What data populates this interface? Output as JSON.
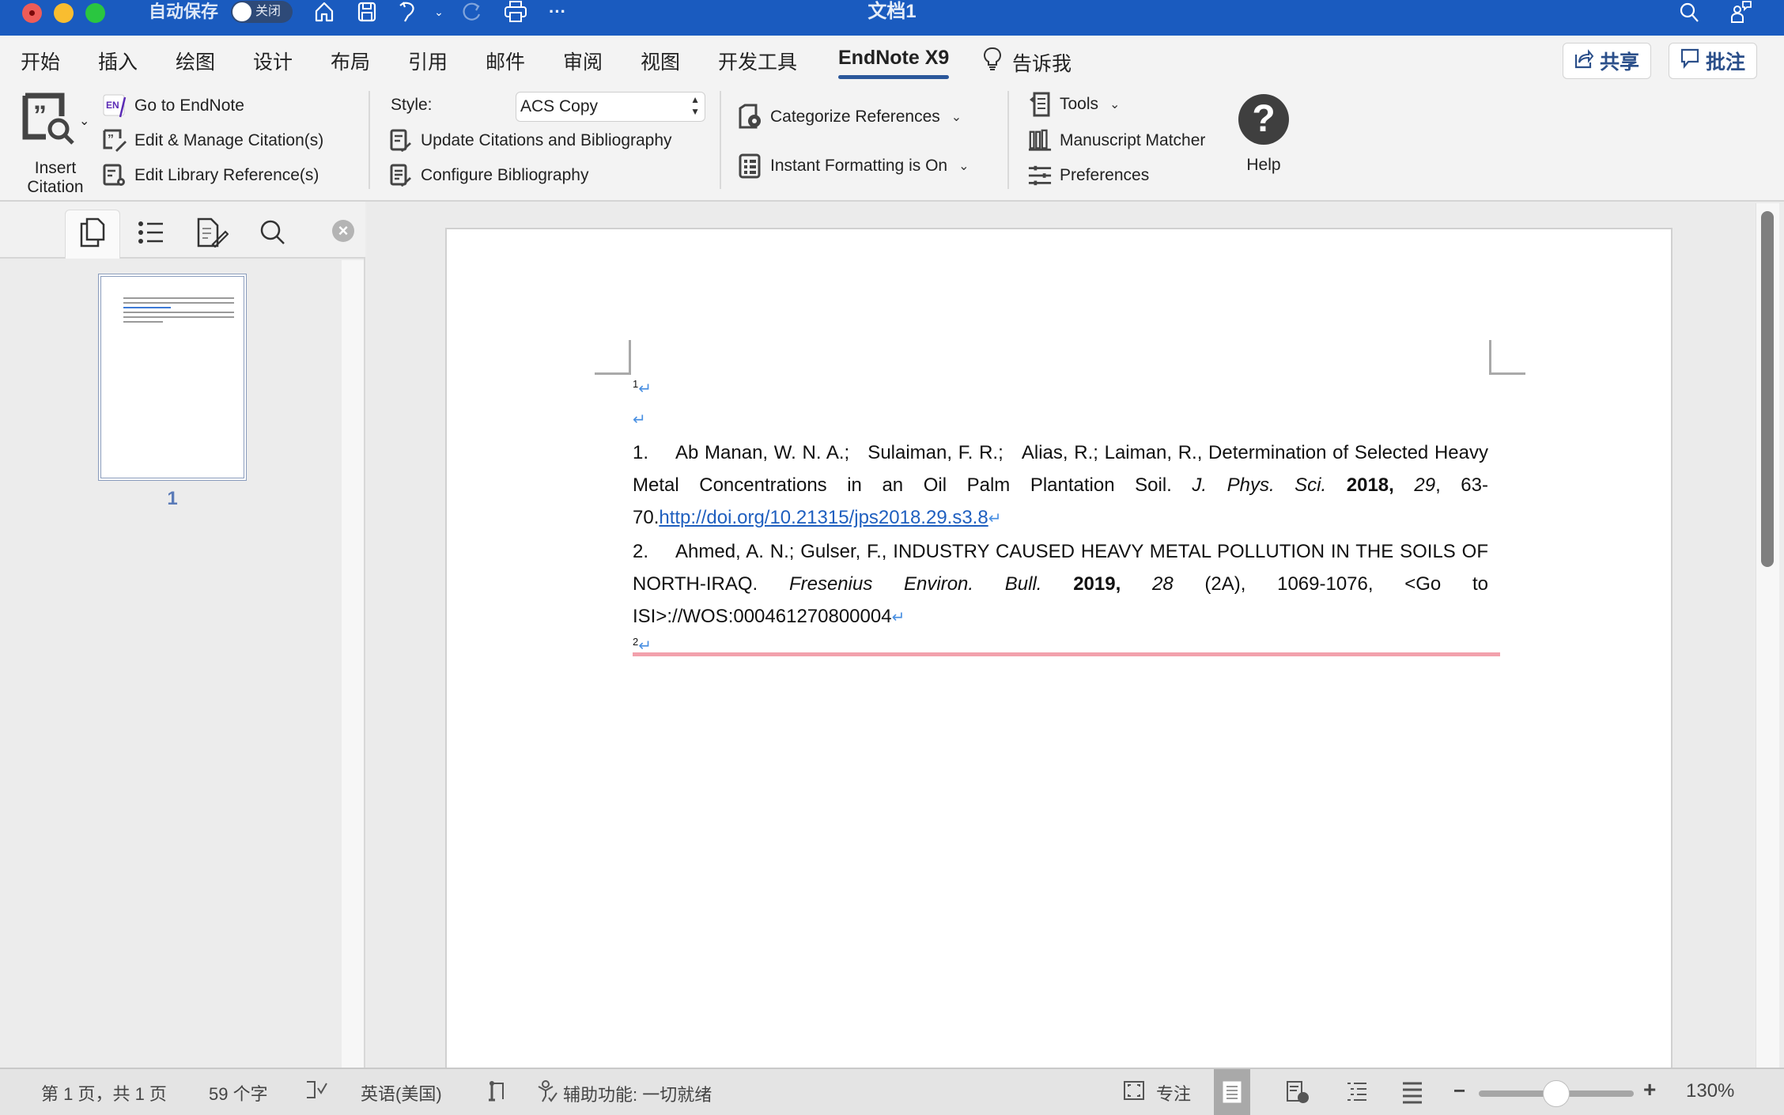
{
  "titlebar": {
    "autosave_label": "自动保存",
    "autosave_state": "关闭",
    "document_title": "文档1",
    "icons": [
      "home-icon",
      "save-icon",
      "undo-icon",
      "undo-dropdown-icon",
      "redo-icon",
      "print-icon",
      "more-icon",
      "search-icon",
      "account-icon"
    ]
  },
  "tabs": [
    {
      "label": "开始"
    },
    {
      "label": "插入"
    },
    {
      "label": "绘图"
    },
    {
      "label": "设计"
    },
    {
      "label": "布局"
    },
    {
      "label": "引用"
    },
    {
      "label": "邮件"
    },
    {
      "label": "审阅"
    },
    {
      "label": "视图"
    },
    {
      "label": "开发工具"
    },
    {
      "label": "EndNote X9",
      "active": true
    }
  ],
  "tell_me": "告诉我",
  "share_button": "共享",
  "comments_button": "批注",
  "ribbon": {
    "insert_citation": "Insert\nCitation",
    "insert_citation_l1": "Insert",
    "insert_citation_l2": "Citation",
    "go_to_endnote": "Go to EndNote",
    "edit_manage_citations": "Edit & Manage Citation(s)",
    "edit_library_references": "Edit Library Reference(s)",
    "style_label": "Style:",
    "style_value": "ACS Copy",
    "update_citations": "Update Citations and Bibliography",
    "configure_bibliography": "Configure Bibliography",
    "categorize_references": "Categorize References",
    "instant_formatting": "Instant Formatting is On",
    "tools": "Tools",
    "manuscript_matcher": "Manuscript Matcher",
    "preferences": "Preferences",
    "help": "Help"
  },
  "sidebar": {
    "tabs": [
      "thumbnails-icon",
      "outline-icon",
      "edit-document-icon",
      "search-icon"
    ],
    "page_number": "1"
  },
  "document": {
    "sup1": "1",
    "sup2": "2",
    "references": [
      {
        "num": "1.",
        "authors": "Ab Manan, W. N. A.;   Sulaiman, F. R.;   Alias, R.; Laiman, R., Determination of Selected Heavy Metal Concentrations in an Oil Palm Plantation Soil. ",
        "journal": "J. Phys. Sci.",
        "year": "2018,",
        "volume": "29",
        "pages": ", 63-70.",
        "link": "http://doi.org/10.21315/jps2018.29.s3.8"
      },
      {
        "num": "2.",
        "authors": "Ahmed, A. N.; Gulser, F., INDUSTRY CAUSED HEAVY METAL POLLUTION IN THE SOILS OF NORTH-IRAQ. ",
        "journal": "Fresenius Environ. Bull.",
        "year": "2019,",
        "volume": "28",
        "pages": " (2A), 1069-1076, <Go to ISI>://WOS:000461270800004"
      }
    ]
  },
  "statusbar": {
    "page_info": "第 1 页，共 1 页",
    "word_count": "59 个字",
    "language": "英语(美国)",
    "accessibility": "辅助功能: 一切就绪",
    "focus": "专注",
    "zoom_level": "130%",
    "zoom_fraction": 0.5
  },
  "colors": {
    "titlebar": "#1a5bbf",
    "active_tab_underline": "#2b579a",
    "link": "#1f5fbf",
    "pink_line": "#f2a1ac"
  }
}
